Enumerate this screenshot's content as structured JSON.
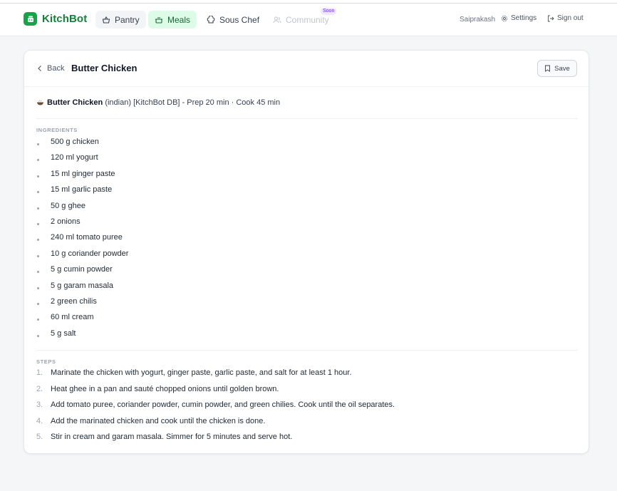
{
  "brand": {
    "name": "KitchBot"
  },
  "nav": {
    "pantry": "Pantry",
    "meals": "Meals",
    "sous_chef": "Sous Chef",
    "community": "Community",
    "soon_badge": "Soon",
    "user_name": "Saiprakash",
    "settings": "Settings",
    "sign_out": "Sign out"
  },
  "colors": {
    "accent": "#16a34a",
    "active_bg": "#dcfce7",
    "badge": "#6d28d9"
  },
  "recipe": {
    "back_label": "Back",
    "title": "Butter Chicken",
    "save_label": "Save",
    "summary": {
      "name": "Butter Chicken",
      "cuisine": "(indian)",
      "source": "[KitchBot DB]",
      "times": "- Prep 20 min · Cook 45 min"
    },
    "ingredients_label": "INGREDIENTS",
    "ingredients": [
      "500 g chicken",
      "120 ml yogurt",
      "15 ml ginger paste",
      "15 ml garlic paste",
      "50 g ghee",
      "2 onions",
      "240 ml tomato puree",
      "10 g coriander powder",
      "5 g cumin powder",
      "5 g garam masala",
      "2 green chilis",
      "60 ml cream",
      "5 g salt"
    ],
    "steps_label": "STEPS",
    "steps": [
      {
        "num": "1.",
        "text": "Marinate the chicken with yogurt, ginger paste, garlic paste, and salt for at least 1 hour."
      },
      {
        "num": "2.",
        "text": "Heat ghee in a pan and sauté chopped onions until golden brown."
      },
      {
        "num": "3.",
        "text": "Add tomato puree, coriander powder, cumin powder, and green chilies. Cook until the oil separates."
      },
      {
        "num": "4.",
        "text": "Add the marinated chicken and cook until the chicken is done."
      },
      {
        "num": "5.",
        "text": "Stir in cream and garam masala. Simmer for 5 minutes and serve hot."
      }
    ]
  }
}
